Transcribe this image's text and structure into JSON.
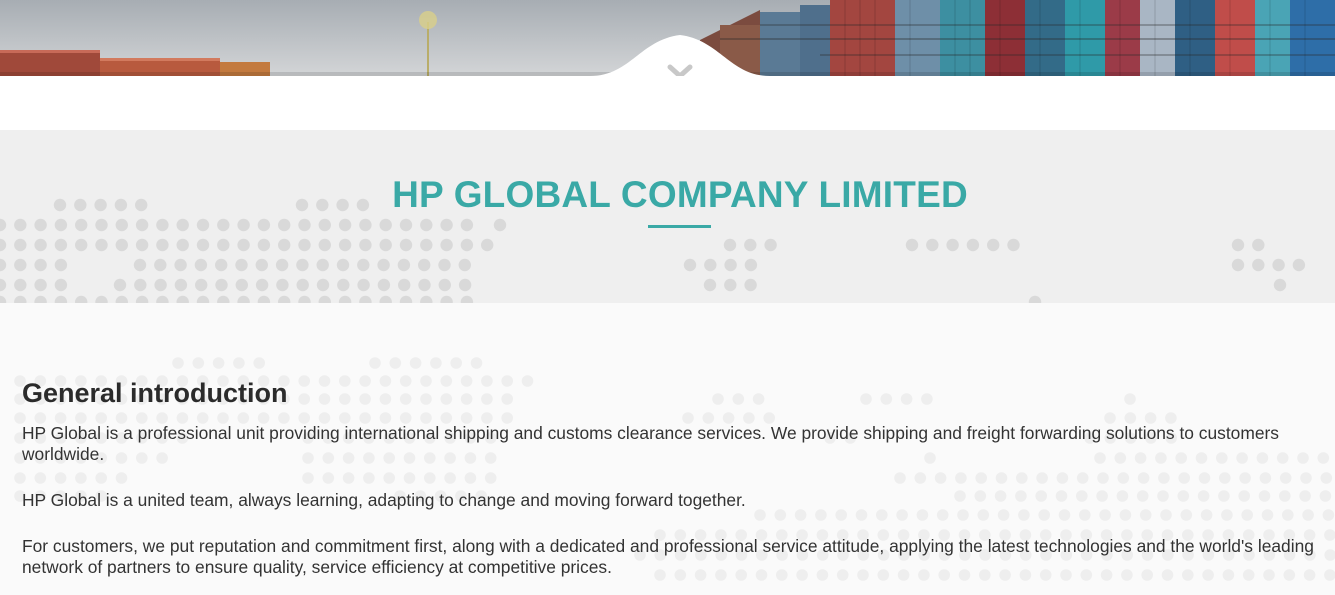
{
  "colors": {
    "accent": "#3aa9a6",
    "band_background": "#efefef",
    "content_background": "#fafafa",
    "text": "#333333"
  },
  "hero": {
    "scroll_icon": "chevron-down-icon"
  },
  "company": {
    "title": "HP GLOBAL COMPANY LIMITED"
  },
  "intro": {
    "heading": "General introduction",
    "paragraphs": [
      "HP Global is a professional unit providing international shipping and customs clearance services. We provide shipping and freight forwarding solutions to customers worldwide.",
      "HP Global is a united team, always learning, adapting to change and moving forward together.",
      "For customers, we put reputation and commitment first, along with a dedicated and professional service attitude, applying the latest technologies and the world's leading network of partners to ensure quality, service efficiency at competitive prices."
    ]
  }
}
